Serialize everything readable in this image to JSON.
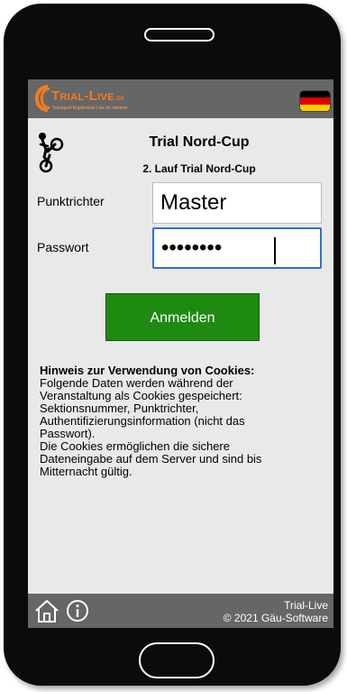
{
  "header": {
    "logo_text": "Trial-Live",
    "logo_tld": ".de",
    "logo_tagline": "Transport Ergebnisse Live im Internet",
    "language_flag": "german-flag-icon",
    "flag_colors": [
      "#000000",
      "#dd0000",
      "#ffce00"
    ]
  },
  "event": {
    "name": "Trial Nord-Cup",
    "run": "2. Lauf Trial Nord-Cup",
    "icon": "trial-rider-icon"
  },
  "form": {
    "judge_label": "Punktrichter",
    "judge_value": "Master",
    "password_label": "Passwort",
    "password_value": "••••••••",
    "login_button": "Anmelden"
  },
  "cookie_notice": {
    "title": "Hinweis zur Verwendung von Cookies:",
    "lines": [
      "Folgende Daten werden während der",
      "Veranstaltung als Cookies gespeichert:",
      "Sektionsnummer, Punktrichter,",
      "Authentifizierungsinformation (nicht das",
      "Passwort).",
      "Die Cookies ermöglichen die sichere",
      "Dateneingabe auf dem Server und sind bis",
      "Mitternacht gültig."
    ]
  },
  "footer": {
    "home_icon": "home-icon",
    "info_icon": "info-icon",
    "app_name": "Trial-Live",
    "copyright": "© 2021 Gäu-Software"
  },
  "colors": {
    "accent_orange": "#f47b20",
    "bar_gray": "#666666",
    "button_green": "#1f8a12",
    "focus_blue": "#2f6fd6"
  }
}
